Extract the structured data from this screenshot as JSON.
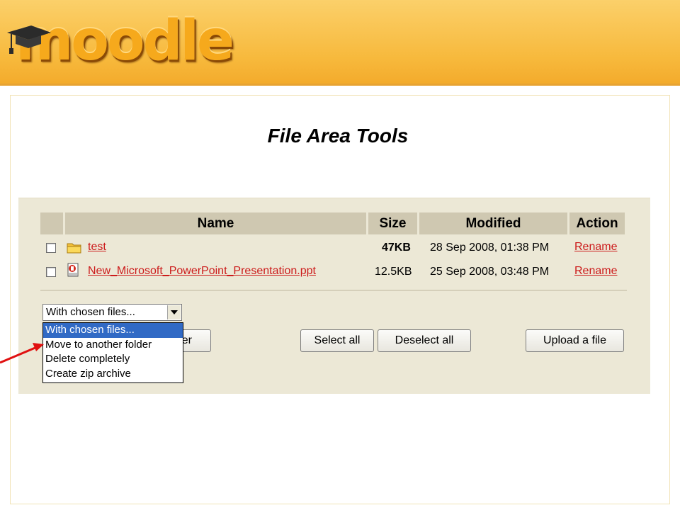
{
  "brand": {
    "logo_text": "moodle"
  },
  "slide": {
    "title": "File Area Tools"
  },
  "table": {
    "headers": {
      "name": "Name",
      "size": "Size",
      "modified": "Modified",
      "action": "Action"
    },
    "rows": [
      {
        "name": "test",
        "size": "47KB",
        "modified": "28 Sep 2008, 01:38 PM",
        "action": "Rename",
        "icon": "folder-icon"
      },
      {
        "name": "New_Microsoft_PowerPoint_Presentation.ppt",
        "size": "12.5KB",
        "modified": "25 Sep 2008, 03:48 PM",
        "action": "Rename",
        "icon": "powerpoint-file-icon"
      }
    ]
  },
  "controls": {
    "select_value": "With chosen files...",
    "options": [
      "With chosen files...",
      "Move to another folder",
      "Delete completely",
      "Create zip archive"
    ],
    "hidden_button_fragment": "er",
    "select_all": "Select all",
    "deselect_all": "Deselect all",
    "upload": "Upload a file"
  },
  "colors": {
    "banner": "#f7b93c",
    "panel": "#ece8d6",
    "header_cell": "#cfc8b1",
    "link": "#cc1b1b",
    "selection": "#316ac5",
    "arrow": "#e01010"
  }
}
